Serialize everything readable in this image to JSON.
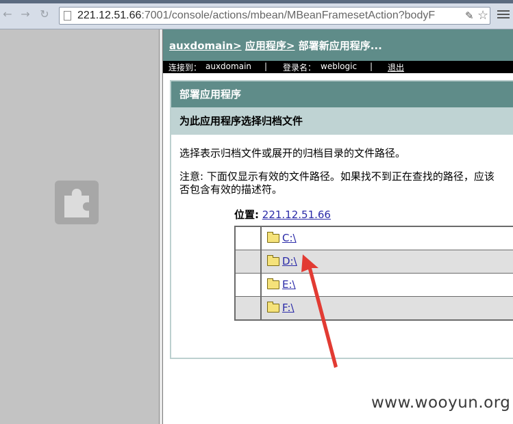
{
  "browser": {
    "url_host": "221.12.51.66",
    "url_rest": ":7001/console/actions/mbean/MBeanFramesetAction?bodyF"
  },
  "header": {
    "crumb_domain": "auxdomain>",
    "crumb_apps": "应用程序>",
    "crumb_current": "部署新应用程序..."
  },
  "status": {
    "connected_label": "连接到：",
    "connected_value": "auxdomain",
    "login_label": "登录名：",
    "login_value": "weblogic",
    "logout": "退出"
  },
  "panel": {
    "title": "部署应用程序",
    "subtitle": "为此应用程序选择归档文件",
    "description": "选择表示归档文件或展开的归档目录的文件路径。",
    "note_line1": "注意: 下面仅显示有效的文件路径。如果找不到正在查找的路径，应该",
    "note_line2": "否包含有效的描述符。",
    "location_label": "位置:",
    "location_value": "221.12.51.66"
  },
  "drives": [
    {
      "label": "C:\\"
    },
    {
      "label": "D:\\"
    },
    {
      "label": "E:\\"
    },
    {
      "label": "F:\\"
    }
  ],
  "watermark": "www.wooyun.org",
  "colors": {
    "accent": "#5f8c89",
    "subheader": "#bfd3d3",
    "annotation": "#e23b33"
  }
}
